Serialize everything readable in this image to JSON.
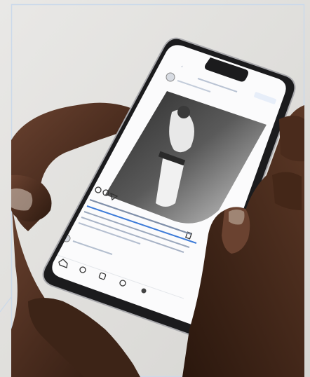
{
  "image": {
    "description_icons": [
      "back-icon",
      "heart-icon",
      "comment-icon",
      "share-icon",
      "bookmark-icon",
      "home-icon",
      "search-icon",
      "reels-icon",
      "shop-icon",
      "profile-icon"
    ],
    "colors": {
      "background": "#e2e1df",
      "frame_border": "#cbd9ea",
      "phone_body": "#1b1b1d",
      "screen": "#fbfbfc",
      "skin_dark": "#3b2418",
      "skin_mid": "#5a3624",
      "accent_link": "#3d7bd8"
    }
  }
}
